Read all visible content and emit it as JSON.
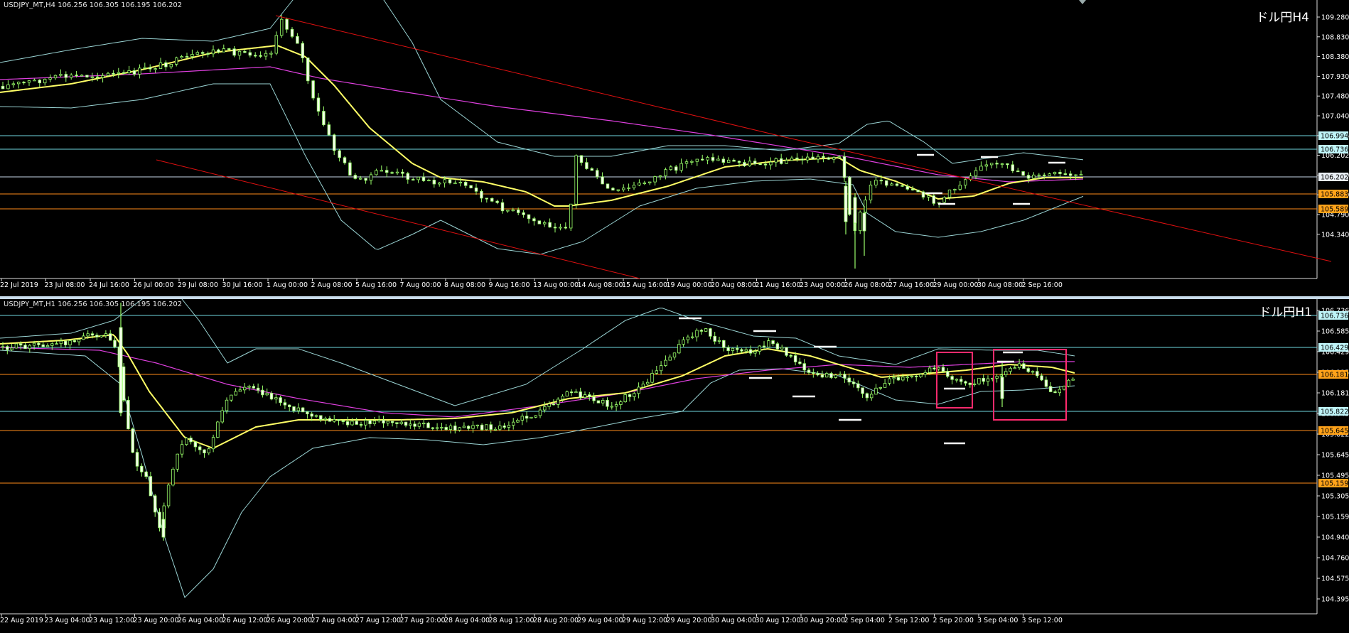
{
  "colors": {
    "background": "#000000",
    "candle": "#9aff6a",
    "ma_short": "#ffff66",
    "ma_long": "#e040e0",
    "bands": "#9bd5d5",
    "hline_cyan": "#70d8e0",
    "hline_orange": "#ff8c1a",
    "trendline": "#e01010",
    "box": "#ff2a6d",
    "grid_text": "#ffffff"
  },
  "panel_h4": {
    "info": "USDJPY_MT,H4  106.256 106.305 106.195 106.202",
    "title": "ドル円H4",
    "yticks": [
      "109.280",
      "108.830",
      "108.380",
      "107.930",
      "107.480",
      "107.040",
      "106.585",
      "106.202",
      "105.690",
      "105.240",
      "104.790",
      "104.340"
    ],
    "levels": [
      {
        "label": "106.994",
        "kind": "cyan"
      },
      {
        "label": "106.736",
        "kind": "cyan"
      },
      {
        "label": "106.202",
        "kind": "white"
      },
      {
        "label": "105.883",
        "kind": "orange"
      },
      {
        "label": "105.589",
        "kind": "orange"
      }
    ],
    "xlabels": [
      "22 Jul 2019",
      "23 Jul 08:00",
      "24 Jul 16:00",
      "26 Jul 00:00",
      "29 Jul 08:00",
      "30 Jul 16:00",
      "1 Aug 00:00",
      "2 Aug 08:00",
      "5 Aug 16:00",
      "7 Aug 00:00",
      "8 Aug 08:00",
      "9 Aug 16:00",
      "13 Aug 00:00",
      "14 Aug 08:00",
      "15 Aug 16:00",
      "19 Aug 00:00",
      "20 Aug 08:00",
      "21 Aug 16:00",
      "23 Aug 00:00",
      "26 Aug 08:00",
      "27 Aug 16:00",
      "29 Aug 00:00",
      "30 Aug 08:00",
      "2 Sep 16:00"
    ]
  },
  "panel_h1": {
    "info": "USDJPY_MT,H1  106.256 106.305 106.195 106.202",
    "title": "ドル円H1",
    "yticks": [
      "106.736",
      "106.585",
      "106.429",
      "106.225",
      "106.181",
      "106.045",
      "105.822",
      "105.645",
      "105.495",
      "105.305",
      "105.159",
      "104.940",
      "104.760",
      "104.575",
      "104.395"
    ],
    "levels": [
      {
        "label": "106.736",
        "kind": "cyan"
      },
      {
        "label": "106.429",
        "kind": "cyan"
      },
      {
        "label": "106.181",
        "kind": "orange"
      },
      {
        "label": "105.822",
        "kind": "cyan"
      },
      {
        "label": "105.645",
        "kind": "orange"
      },
      {
        "label": "105.159",
        "kind": "orange"
      }
    ],
    "xlabels": [
      "22 Aug 2019",
      "23 Aug 04:00",
      "23 Aug 12:00",
      "23 Aug 20:00",
      "26 Aug 04:00",
      "26 Aug 12:00",
      "26 Aug 20:00",
      "27 Aug 04:00",
      "27 Aug 12:00",
      "27 Aug 20:00",
      "28 Aug 04:00",
      "28 Aug 12:00",
      "28 Aug 20:00",
      "29 Aug 04:00",
      "29 Aug 12:00",
      "29 Aug 20:00",
      "30 Aug 04:00",
      "30 Aug 12:00",
      "30 Aug 20:00",
      "2 Sep 04:00",
      "2 Sep 12:00",
      "2 Sep 20:00",
      "3 Sep 04:00",
      "3 Sep 12:00"
    ]
  }
}
